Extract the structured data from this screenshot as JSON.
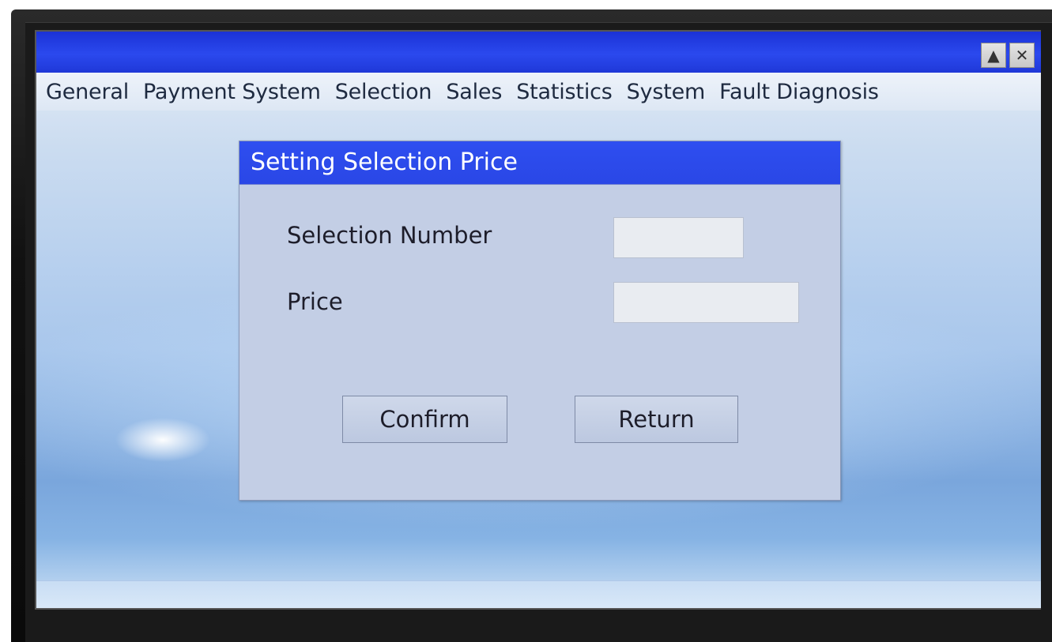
{
  "window": {
    "controls": [
      {
        "icon": "up-arrow-icon",
        "glyph": "▲"
      },
      {
        "icon": "close-icon",
        "glyph": "✕"
      }
    ]
  },
  "menu": {
    "items": [
      "General",
      "Payment System",
      "Selection",
      "Sales",
      "Statistics",
      "System",
      "Fault Diagnosis"
    ]
  },
  "dialog": {
    "title": "Setting Selection Price",
    "fields": [
      {
        "label": "Selection Number",
        "value": ""
      },
      {
        "label": "Price",
        "value": ""
      }
    ],
    "buttons": {
      "confirm": "Confirm",
      "return": "Return"
    }
  },
  "colors": {
    "titlebar": "#2b49ee",
    "dialog_title": "#2e4ef0",
    "dialog_body": "#c3cee5"
  }
}
